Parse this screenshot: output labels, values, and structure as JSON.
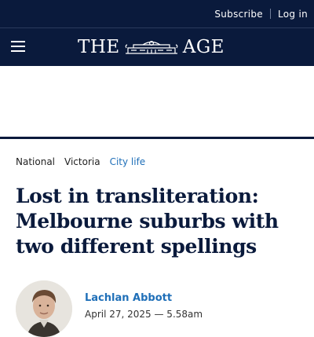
{
  "header": {
    "subscribe_label": "Subscribe",
    "login_label": "Log in",
    "logo_left": "THE",
    "logo_right": "AGE",
    "background": "#0a1a3c"
  },
  "breadcrumbs": [
    "National",
    "Victoria",
    "City life"
  ],
  "article": {
    "headline": "Lost in transliteration: Melbourne suburbs with two different spellings",
    "author": "Lachlan Abbott",
    "date": "April 27, 2025 — 5.58am"
  },
  "colors": {
    "navy": "#0a1a3c",
    "link_blue": "#1f6fb8"
  }
}
